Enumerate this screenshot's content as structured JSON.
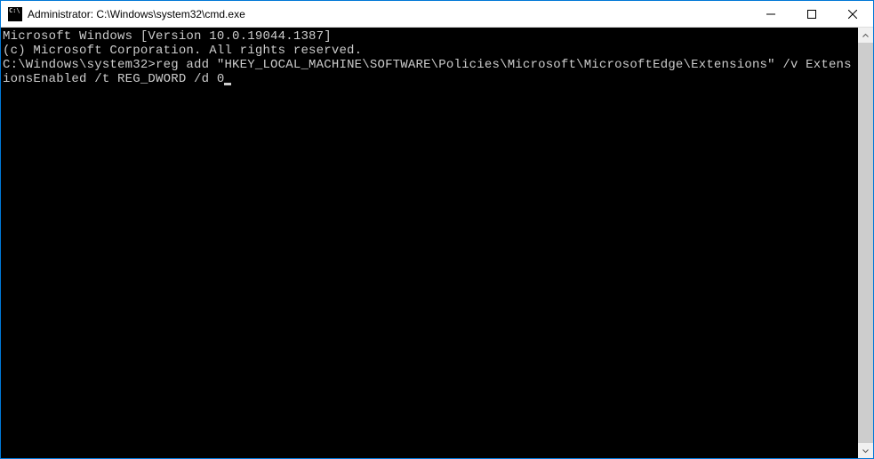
{
  "titlebar": {
    "icon_text": "C:\\",
    "title": "Administrator: C:\\Windows\\system32\\cmd.exe"
  },
  "terminal": {
    "line1": "Microsoft Windows [Version 10.0.19044.1387]",
    "line2": "(c) Microsoft Corporation. All rights reserved.",
    "blank": "",
    "prompt": "C:\\Windows\\system32>",
    "command": "reg add \"HKEY_LOCAL_MACHINE\\SOFTWARE\\Policies\\Microsoft\\MicrosoftEdge\\Extensions\" /v ExtensionsEnabled /t REG_DWORD /d 0"
  }
}
